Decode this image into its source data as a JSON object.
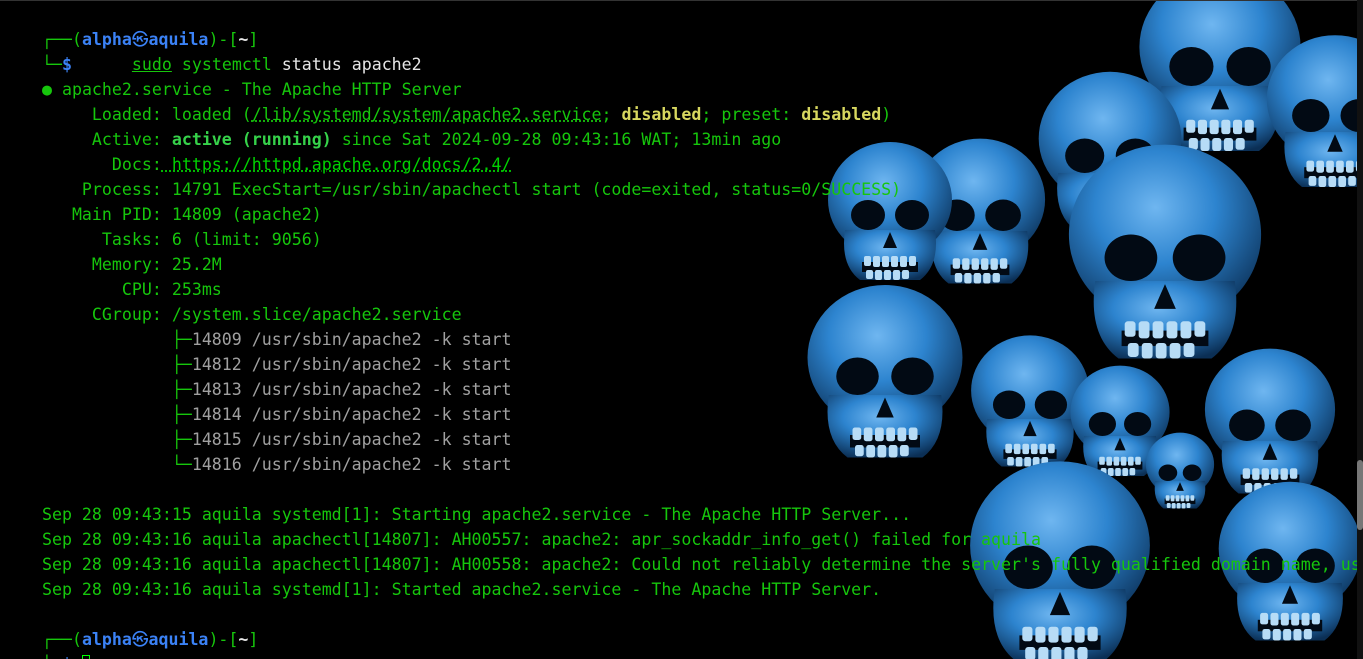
{
  "terminal": {
    "prompt1": {
      "corner_top": "┌──(",
      "user": "alpha",
      "at_symbol": "㉿",
      "host": "aquila",
      "close_paren": ")-[",
      "cwd": "~",
      "close_bracket": "]",
      "corner_bottom": "└─",
      "dollar": "$",
      "cmd_sudo": "sudo",
      "cmd_systemctl": "systemctl",
      "cmd_rest": " status apache2"
    },
    "status": {
      "bullet": "●",
      "title": " apache2.service - The Apache HTTP Server",
      "loaded_label": "     Loaded:",
      "loaded_value_a": " loaded (",
      "loaded_path": "/lib/systemd/system/apache2.service",
      "loaded_value_b": "; ",
      "loaded_disabled": "disabled",
      "loaded_value_c": "; preset: ",
      "loaded_preset": "disabled",
      "loaded_value_d": ")",
      "active_label": "     Active:",
      "active_state": " active (running)",
      "active_rest": " since Sat 2024-09-28 09:43:16 WAT; 13min ago",
      "docs_label": "       Docs:",
      "docs_url": " https://httpd.apache.org/docs/2.4/",
      "process_label": "    Process:",
      "process_value": " 14791 ExecStart=/usr/sbin/apachectl start (code=exited, status=0/SUCCESS)",
      "mainpid_label": "   Main PID:",
      "mainpid_value": " 14809 (apache2)",
      "tasks_label": "      Tasks:",
      "tasks_value": " 6 (limit: 9056)",
      "memory_label": "     Memory:",
      "memory_value": " 25.2M",
      "cpu_label": "        CPU:",
      "cpu_value": " 253ms",
      "cgroup_label": "     CGroup:",
      "cgroup_value": " /system.slice/apache2.service",
      "tree": [
        {
          "branch": "             ├─",
          "entry": "14809 /usr/sbin/apache2 -k start"
        },
        {
          "branch": "             ├─",
          "entry": "14812 /usr/sbin/apache2 -k start"
        },
        {
          "branch": "             ├─",
          "entry": "14813 /usr/sbin/apache2 -k start"
        },
        {
          "branch": "             ├─",
          "entry": "14814 /usr/sbin/apache2 -k start"
        },
        {
          "branch": "             ├─",
          "entry": "14815 /usr/sbin/apache2 -k start"
        },
        {
          "branch": "             └─",
          "entry": "14816 /usr/sbin/apache2 -k start"
        }
      ]
    },
    "logs": [
      "Sep 28 09:43:15 aquila systemd[1]: Starting apache2.service - The Apache HTTP Server...",
      "Sep 28 09:43:16 aquila apachectl[14807]: AH00557: apache2: apr_sockaddr_info_get() failed for aquila",
      "Sep 28 09:43:16 aquila apachectl[14807]: AH00558: apache2: Could not reliably determine the server's fully qualified domain name, usin",
      "Sep 28 09:43:16 aquila systemd[1]: Started apache2.service - The Apache HTTP Server."
    ],
    "log_overflow_marker": ">",
    "prompt2": {
      "corner_top": "┌──(",
      "user": "alpha",
      "at_symbol": "㉿",
      "host": "aquila",
      "close_paren": ")-[",
      "cwd": "~",
      "close_bracket": "]",
      "corner_bottom": "└─",
      "dollar": "$"
    }
  },
  "wallpaper": {
    "subject": "skulls",
    "color": "#2f8fd8"
  },
  "colors": {
    "background": "#000000",
    "text_green": "#16c60c",
    "prompt_blue": "#3b82f6",
    "bold_yellow": "#d7d75f",
    "cursor": "#00ff00"
  }
}
